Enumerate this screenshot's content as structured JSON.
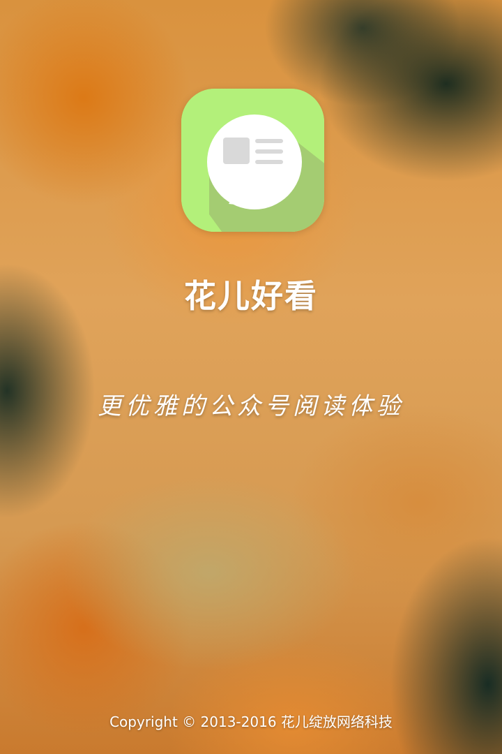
{
  "app": {
    "name": "花儿好看",
    "slogan": "更优雅的公众号阅读体验",
    "copyright": "Copyright © 2013-2016 花儿绽放网络科技",
    "icon": "chat-bubble-article-icon"
  },
  "colors": {
    "icon_background": "#b3f07a",
    "icon_shadow": "#a2c871",
    "bubble": "#ffffff",
    "bubble_content": "#d9d9d9",
    "text": "#ffffff"
  }
}
